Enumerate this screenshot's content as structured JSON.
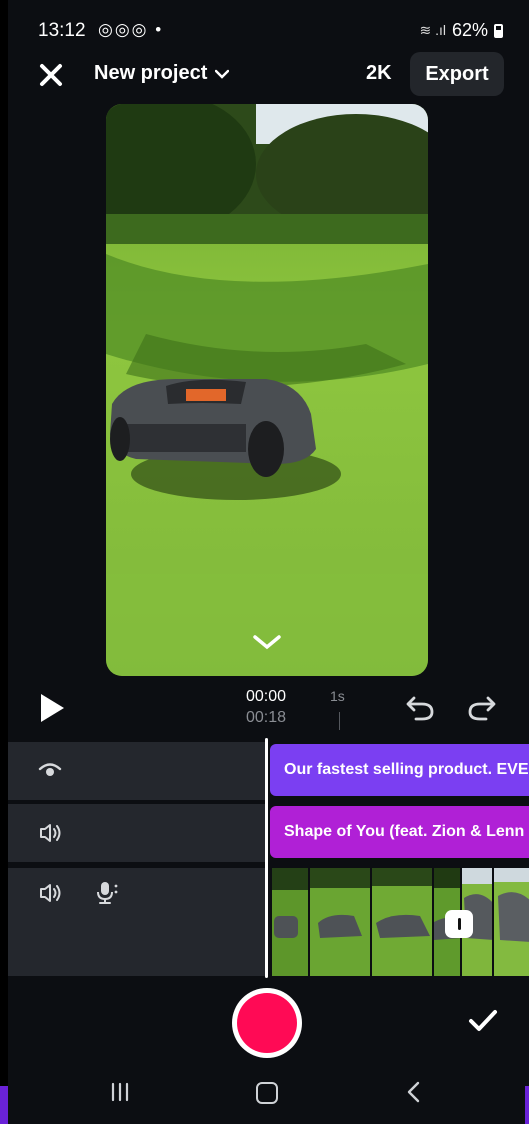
{
  "status_bar": {
    "time": "13:12",
    "notification_icons": "◎◎◎ •",
    "battery": "62%"
  },
  "header": {
    "project_name": "New project",
    "resolution": "2K",
    "export_label": "Export"
  },
  "playback": {
    "current_time": "00:00",
    "total_time": "00:18",
    "ruler_label": "1s"
  },
  "tracks": {
    "text_clip": "Our fastest selling product. EVE",
    "audio_clip": "Shape of You (feat. Zion & Lenn"
  },
  "colors": {
    "background": "#0c0e12",
    "text_clip": "#7b3ff2",
    "audio_clip": "#b020d6",
    "record": "#ff0a55"
  },
  "icons": [
    "close-icon",
    "chevron-down-icon",
    "play-icon",
    "undo-icon",
    "redo-icon",
    "eye-icon",
    "speaker-icon",
    "voiceover-mic-icon",
    "record-button",
    "check-icon"
  ]
}
